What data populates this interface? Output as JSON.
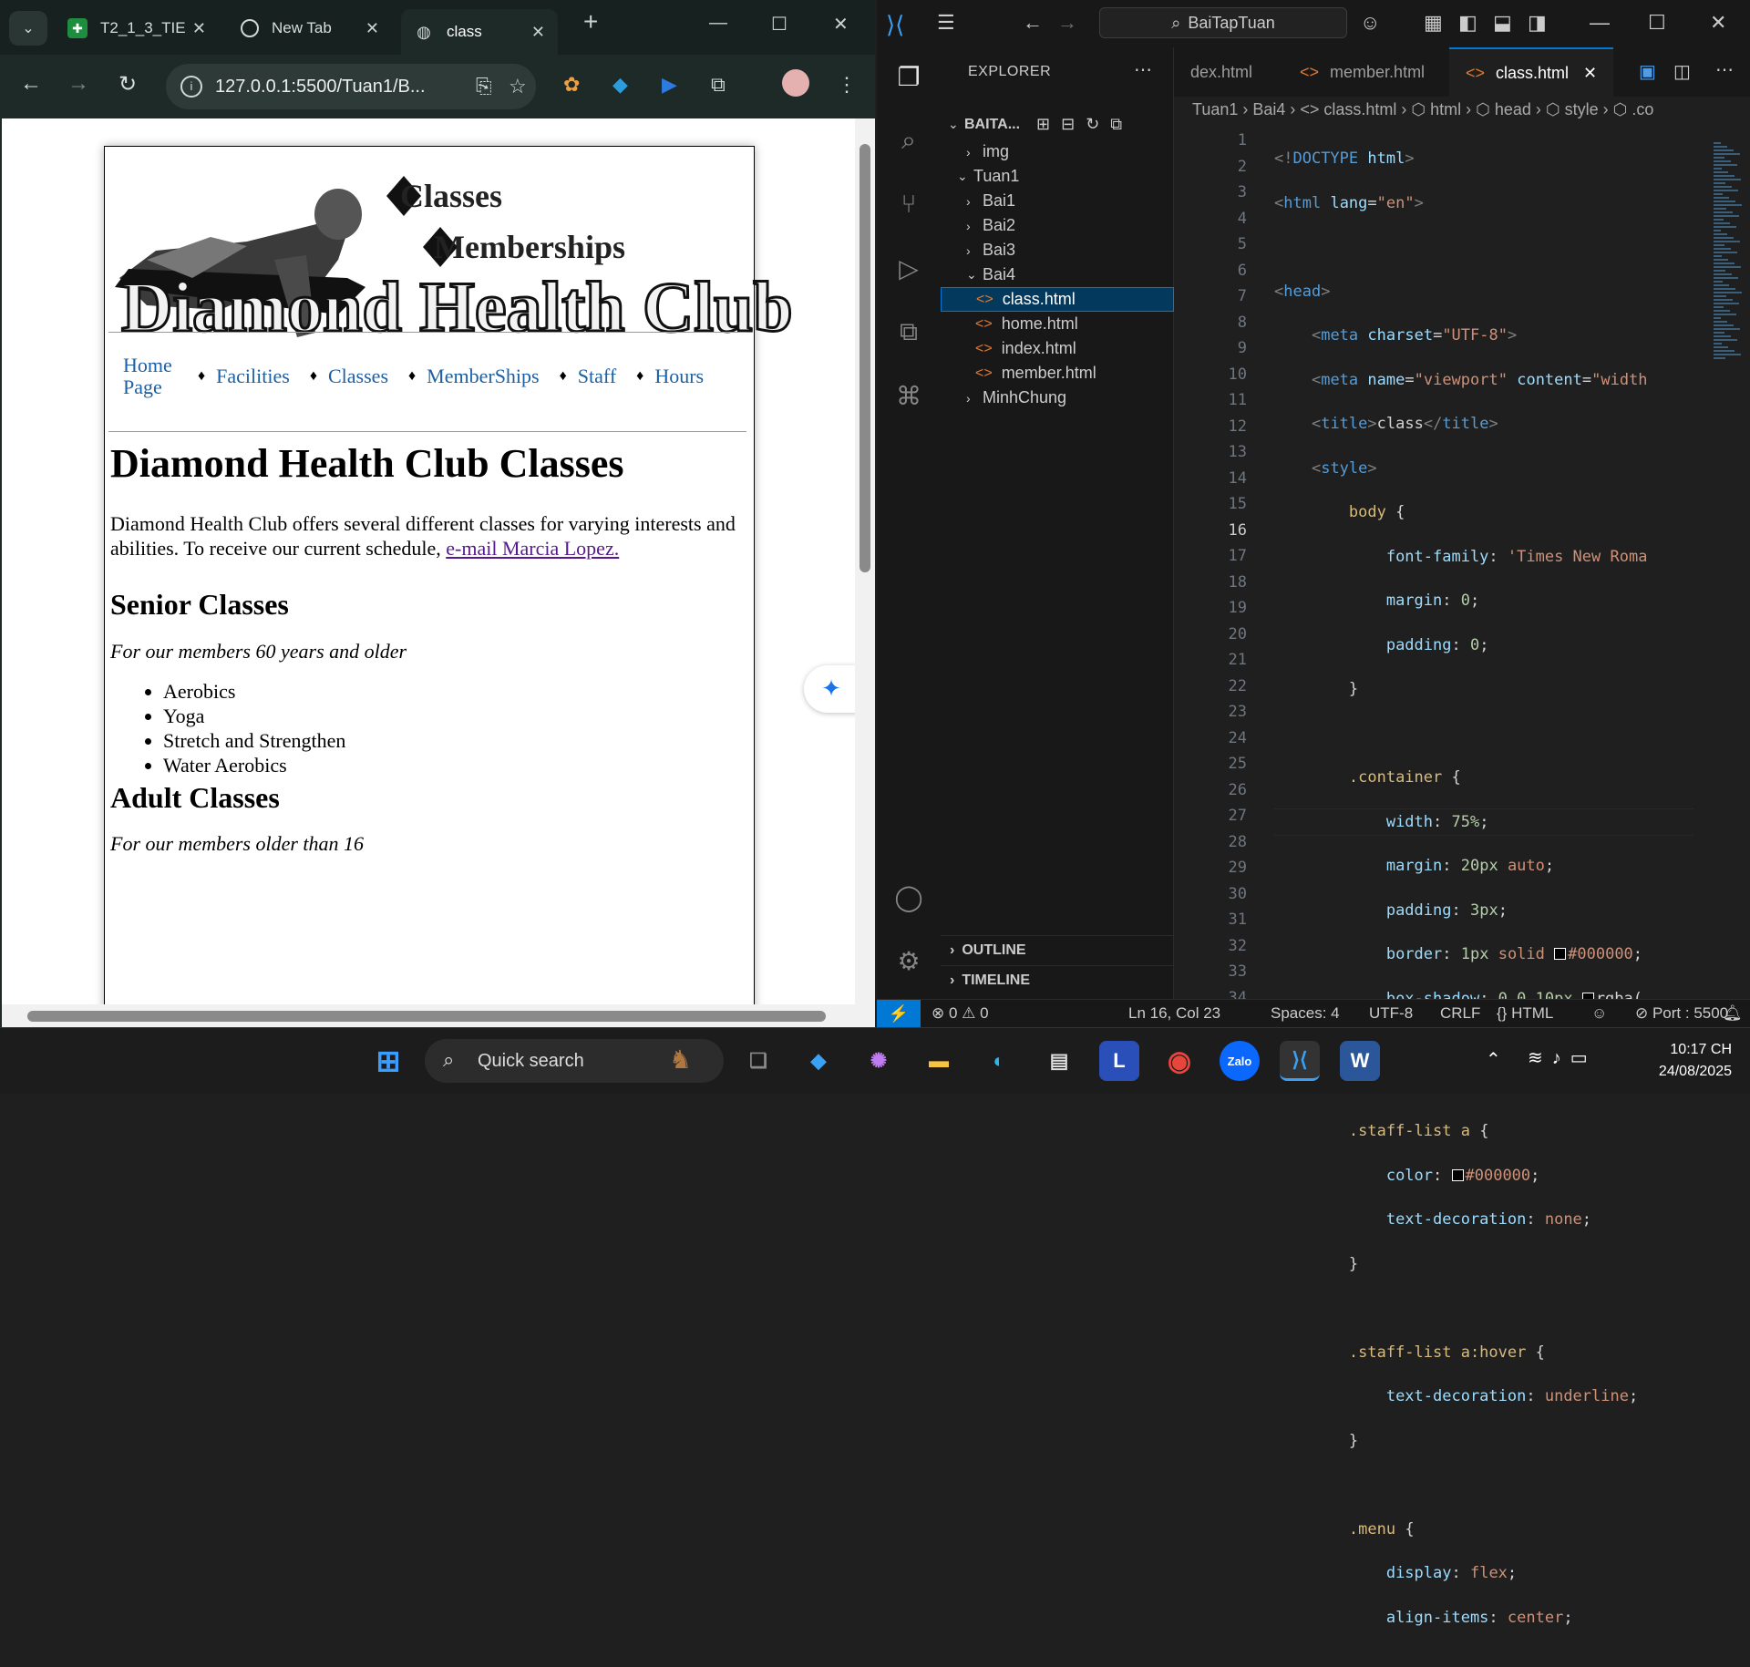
{
  "chrome": {
    "tabs": [
      {
        "title": "T2_1_3_TIE",
        "icon": "sheets-icon"
      },
      {
        "title": "New Tab",
        "icon": "chrome-icon"
      },
      {
        "title": "class",
        "icon": "globe-icon",
        "active": true
      }
    ],
    "url": "127.0.0.1:5500/Tuan1/B..."
  },
  "page": {
    "banner_line1": "Classes",
    "banner_line2": "Memberships",
    "banner_title": "Diamond Health Club",
    "menu": [
      "Home Page",
      "Facilities",
      "Classes",
      "MemberShips",
      "Staff",
      "Hours"
    ],
    "separator": "♦",
    "heading": "Diamond Health Club Classes",
    "intro": "Diamond Health Club offers several different classes for varying interests and abilities. To receive our current schedule, ",
    "intro_link": "e-mail Marcia Lopez.",
    "senior_heading": "Senior Classes",
    "senior_note": "For our members 60 years and older",
    "senior_items": [
      "Aerobics",
      "Yoga",
      "Stretch and Strengthen",
      "Water Aerobics"
    ],
    "adult_heading": "Adult Classes",
    "adult_note": "For our members older than 16"
  },
  "vscode": {
    "search": "BaiTapTuan",
    "explorer_title": "EXPLORER",
    "workspace": "BAITA...",
    "tree": [
      {
        "label": "img",
        "type": "folder",
        "depth": 1,
        "open": false
      },
      {
        "label": "Tuan1",
        "type": "folder",
        "depth": 0,
        "open": true
      },
      {
        "label": "Bai1",
        "type": "folder",
        "depth": 1,
        "open": false
      },
      {
        "label": "Bai2",
        "type": "folder",
        "depth": 1,
        "open": false
      },
      {
        "label": "Bai3",
        "type": "folder",
        "depth": 1,
        "open": false
      },
      {
        "label": "Bai4",
        "type": "folder",
        "depth": 1,
        "open": true
      },
      {
        "label": "class.html",
        "type": "file",
        "depth": 2,
        "selected": true
      },
      {
        "label": "home.html",
        "type": "file",
        "depth": 2
      },
      {
        "label": "index.html",
        "type": "file",
        "depth": 2
      },
      {
        "label": "member.html",
        "type": "file",
        "depth": 2
      },
      {
        "label": "MinhChung",
        "type": "folder",
        "depth": 1,
        "open": false
      }
    ],
    "outline_label": "OUTLINE",
    "timeline_label": "TIMELINE",
    "tabs": [
      "dex.html",
      "member.html",
      "class.html"
    ],
    "breadcrumb": "Tuan1 › Bai4 › <> class.html › ⬡ html › ⬡ head › ⬡ style › ⬡ .co",
    "status": {
      "errors": "0",
      "warnings": "0",
      "position": "Ln 16, Col 23",
      "spaces": "Spaces: 4",
      "encoding": "UTF-8",
      "eol": "CRLF",
      "language": "{} HTML",
      "port": "Port : 5500"
    }
  },
  "taskbar": {
    "search": "Quick search",
    "time": "10:17 CH",
    "date": "24/08/2025"
  }
}
